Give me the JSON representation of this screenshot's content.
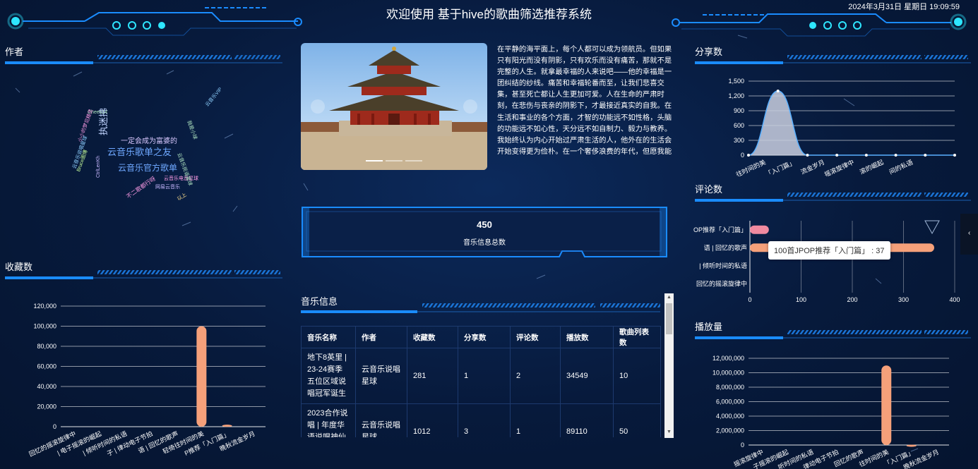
{
  "header": {
    "title": "欢迎使用 基于hive的歌曲筛选推荐系统",
    "datetime": "2024年3月31日 星期日 19:09:59"
  },
  "panels": {
    "author": "作者",
    "favorites": "收藏数",
    "shares": "分享数",
    "comments": "评论数",
    "plays": "播放量",
    "music_info": "音乐信息"
  },
  "author_cloud": [
    "云音乐歌单之友",
    "云音乐官方歌单",
    "一定会成为富婆的",
    "执迷拂",
    "Chees14",
    "云音乐VIP",
    "云音乐电音星球",
    "不二歌都行呀",
    "网易云音乐",
    "Bruce图博",
    "CtrlLenKh",
    "小小的梦见精灵",
    "云音乐说唱星球",
    "云音乐民谣星球",
    "我是小球",
    "以上"
  ],
  "article": {
    "text": "在平静的海平面上，每个人都可以成为领航员。但如果只有阳光而没有阴影，只有欢乐而没有痛苦，那就不是完整的人生。就拿最幸福的人来说吧——他的幸福是一团纠结的纱线。痛苦和幸福轮番而至，让我们悲喜交集，甚至死亡都让人生更加可爱。人在生命的严肃时刻，在悲伤与丧亲的阴影下，才最接近真实的自我。在生活和事业的各个方面，才智的功能远不如性格，头脑的功能远不如心性，天分远不如自制力、毅力与教养。我始终认为内心开始过严肃生活的人，他外在的生活会开始变得更为俭朴。在一个奢侈浪费的年代，但愿我能"
  },
  "summary": {
    "total_value": "450",
    "total_label": "音乐信息总数"
  },
  "table": {
    "columns": [
      "音乐名称",
      "作者",
      "收藏数",
      "分享数",
      "评论数",
      "播放数",
      "歌曲列表数"
    ],
    "rows": [
      [
        "地下8英里 | 23-24赛季五位区域说唱冠军诞生",
        "云音乐说唱星球",
        "281",
        "1",
        "2",
        "34549",
        "10"
      ],
      [
        "2023合作说唱 | 年度华语说唱神仙合作",
        "云音乐说唱星球",
        "1012",
        "3",
        "1",
        "89110",
        "50"
      ]
    ]
  },
  "tooltip": {
    "text": "100首JPOP推荐「入门篇」 : 37"
  },
  "chart_data": [
    {
      "id": "favorites",
      "type": "bar",
      "categories": [
        "回忆的摇滚旋律中",
        "电子摇滚的崛起",
        "倾听时间的私语",
        "律动电子节拍",
        "回忆的歌声",
        "轻倚往时间的美",
        "JPOP推荐「入门篇」",
        "晚秋流金岁月"
      ],
      "values": [
        0,
        0,
        0,
        0,
        0,
        100000,
        2000,
        0
      ],
      "ylim": [
        0,
        120000
      ],
      "yticks": [
        "0",
        "20,000",
        "40,000",
        "60,000",
        "80,000",
        "100,000",
        "120,000"
      ],
      "xlabels": [
        "回忆的摇滚旋律中",
        "| 电子摇滚的崛起",
        "| 倾听时间的私语",
        "子 | 律动电子节拍",
        "语 | 回忆的歌声",
        "轻倚往时间的美",
        "P推荐「入门篇」",
        "晚秋流金岁月"
      ],
      "color": "#f5a07a"
    },
    {
      "id": "shares",
      "type": "area",
      "categories": [
        "轻倚往时间的美",
        "JPOP推荐「入门篇」",
        "晚秋流金岁月",
        "回忆的摇滚旋律中",
        "电子摇滚的崛起",
        "倾听时间的私语",
        "律动电子节拍"
      ],
      "values": [
        0,
        1300,
        0,
        0,
        0,
        0,
        0,
        0
      ],
      "ylim": [
        0,
        1500
      ],
      "yticks": [
        "0",
        "300",
        "600",
        "900",
        "1,200",
        "1,500"
      ],
      "xlabels": [
        "往时间的美",
        "「入门篇」",
        "流金岁月",
        "摇滚旋律中",
        "滚的崛起",
        "间的私语"
      ],
      "color": "#c9cfe0"
    },
    {
      "id": "comments",
      "type": "bar",
      "orientation": "horizontal",
      "categories": [
        "100首JPOP推荐「入门篇」",
        "回忆的歌声",
        "倾听时间的私语",
        "回忆的摇滚旋律中"
      ],
      "values": [
        37,
        360,
        0,
        0
      ],
      "xlim": [
        0,
        400
      ],
      "xticks": [
        "0",
        "100",
        "200",
        "300",
        "400"
      ],
      "ylabels": [
        "OP推荐「入门篇」",
        "语 | 回忆的歌声",
        "| 倾听时间的私语",
        "回忆的摇滚旋律中"
      ],
      "colors": [
        "#f08aa0",
        "#f5a07a",
        "#f5a07a",
        "#f5a07a"
      ]
    },
    {
      "id": "plays",
      "type": "bar",
      "categories": [
        "回忆的摇滚旋律中",
        "电子摇滚的崛起",
        "倾听时间的私语",
        "律动电子节拍",
        "回忆的歌声",
        "轻倚往时间的美",
        "JPOP推荐「入门篇」",
        "晚秋流金岁月"
      ],
      "values": [
        0,
        0,
        0,
        0,
        0,
        11000000,
        50000,
        0
      ],
      "ylim": [
        0,
        12000000
      ],
      "yticks": [
        "0",
        "2,000,000",
        "4,000,000",
        "6,000,000",
        "8,000,000",
        "10,000,000",
        "12,000,000"
      ],
      "xlabels": [
        "摇滚旋律中",
        "子摇滚的崛起",
        "听时间的私语",
        "律动电子节拍",
        "回忆的歌声",
        "往时间的美",
        "「入门篇」",
        "晚秋流金岁月"
      ],
      "color": "#f5a07a"
    }
  ]
}
